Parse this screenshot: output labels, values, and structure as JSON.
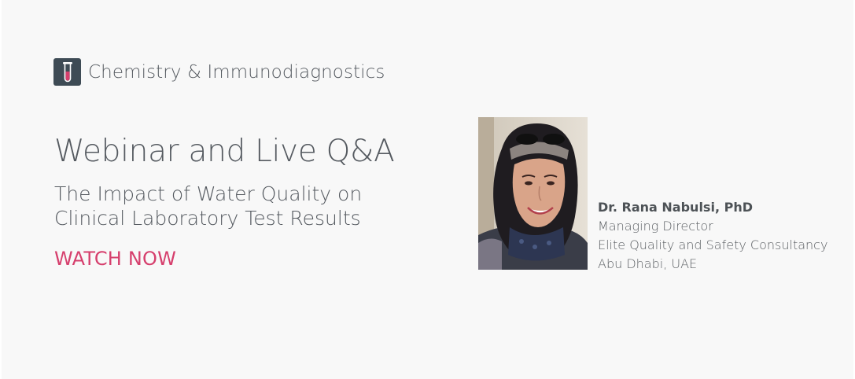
{
  "brand": {
    "name": "Chemistry & Immunodiagnostics",
    "logo_icon": "test-tube-icon"
  },
  "webinar": {
    "headline": "Webinar and Live Q&A",
    "subtitle_line1": "The Impact of Water Quality on",
    "subtitle_line2": "Clinical Laboratory Test Results",
    "cta_label": "WATCH NOW"
  },
  "speaker": {
    "name": "Dr. Rana Nabulsi, PhD",
    "role": "Managing Director",
    "organization": "Elite Quality and Safety Consultancy",
    "location": "Abu Dhabi, UAE"
  },
  "colors": {
    "background": "#f8f8f8",
    "text": "#555a60",
    "accent": "#d63f6d",
    "logo_bg": "#3e4b55"
  }
}
